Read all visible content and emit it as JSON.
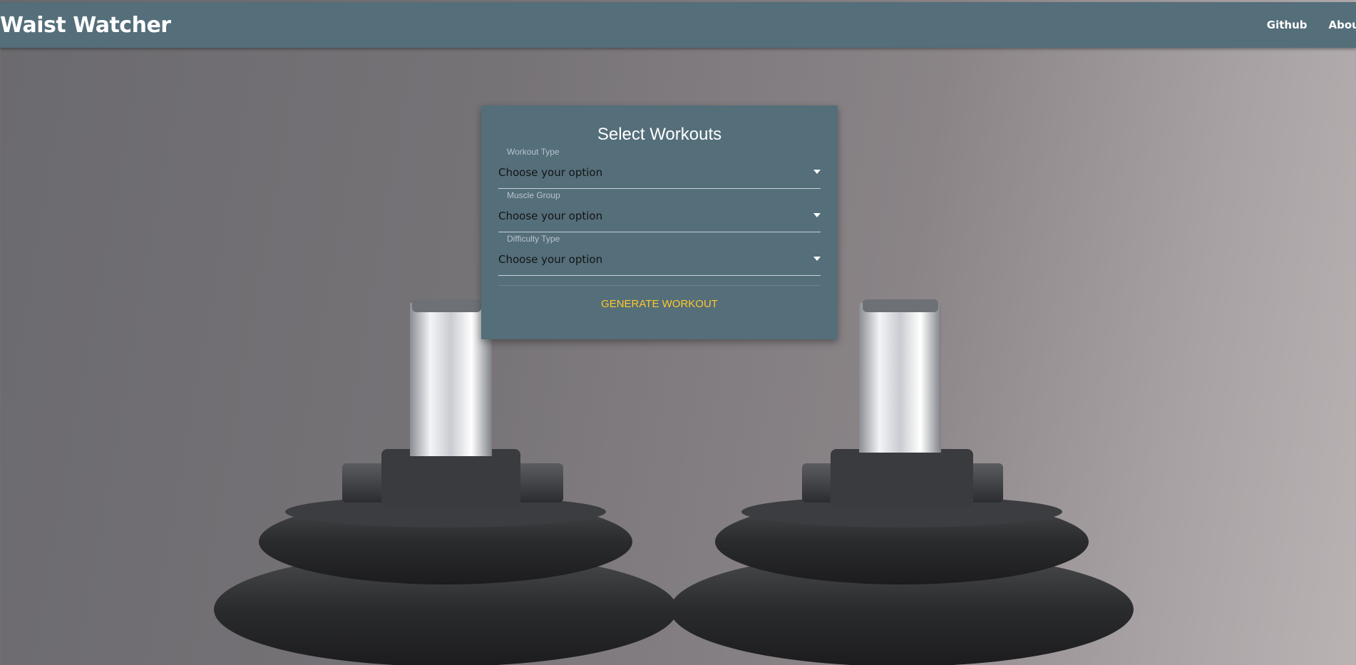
{
  "navbar": {
    "brand": "Waist Watcher",
    "links": [
      "Github",
      "About"
    ]
  },
  "card": {
    "title": "Select Workouts",
    "fields": [
      {
        "label": "Workout Type",
        "value": "Choose your option"
      },
      {
        "label": "Muscle Group",
        "value": "Choose your option"
      },
      {
        "label": "Difficulty Type",
        "value": "Choose your option"
      }
    ],
    "action": "GENERATE WORKOUT"
  },
  "icons": {
    "dropdown": "caret-down-icon"
  },
  "colors": {
    "navbar": "#546e7a",
    "card": "#546e7a",
    "action": "#ffc928",
    "text": "#ffffff"
  }
}
